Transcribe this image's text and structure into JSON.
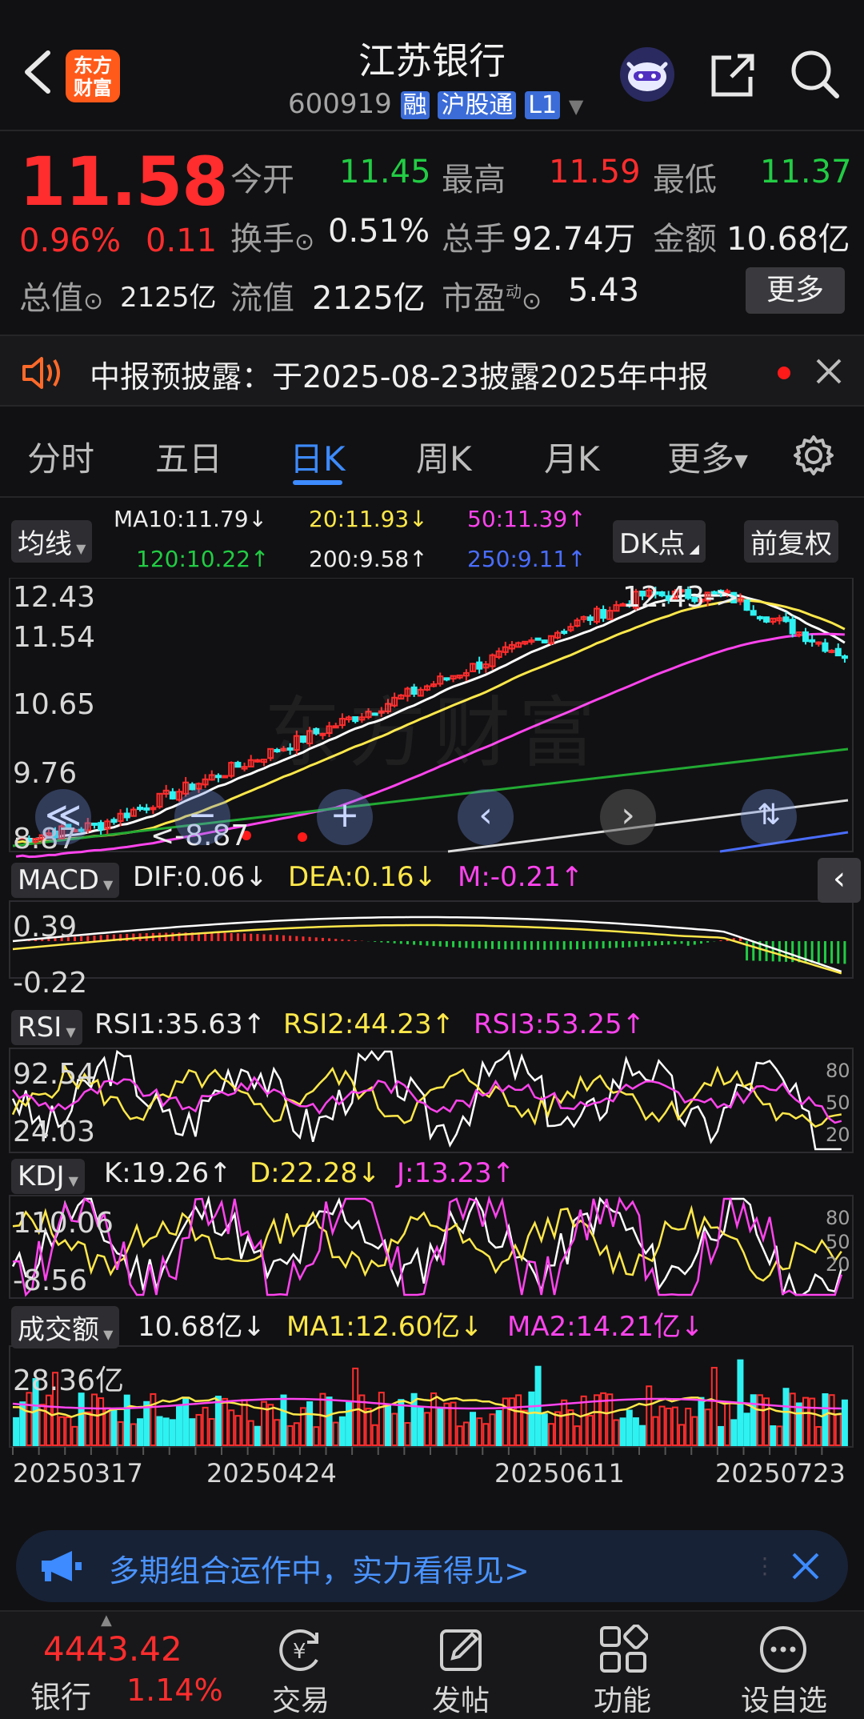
{
  "header": {
    "title": "江苏银行",
    "code": "600919",
    "badges": [
      "融",
      "沪股通",
      "L1"
    ],
    "logo_text": "东方\n财富"
  },
  "quote": {
    "price": "11.58",
    "change_pct": "0.96%",
    "change": "0.11",
    "open_label": "今开",
    "open": "11.45",
    "high_label": "最高",
    "high": "11.59",
    "low_label": "最低",
    "low": "11.37",
    "turnover_label": "换手",
    "turnover": "0.51%",
    "volume_label": "总手",
    "volume": "92.74万",
    "amount_label": "金额",
    "amount": "10.68亿",
    "mktcap_label": "总值",
    "mktcap": "2125亿",
    "float_label": "流值",
    "float": "2125亿",
    "pe_label": "市盈",
    "pe_sup": "动",
    "pe": "5.43",
    "more_label": "更多"
  },
  "notice": {
    "text": "中报预披露：于2025-08-23披露2025年中报"
  },
  "tabs": [
    {
      "label": "分时"
    },
    {
      "label": "五日"
    },
    {
      "label": "日K"
    },
    {
      "label": "周K"
    },
    {
      "label": "月K"
    },
    {
      "label": "更多"
    }
  ],
  "ma": {
    "selector": "均线",
    "ma10": "MA10:11.79↓",
    "ma20": "20:11.93↓",
    "ma50": "50:11.39↑",
    "ma120": "120:10.22↑",
    "ma200": "200:9.58↑",
    "ma250": "250:9.11↑",
    "dk": "DK点",
    "fq": "前复权"
  },
  "kline": {
    "axis": [
      "12.43",
      "11.54",
      "10.65",
      "9.76",
      "8.87"
    ],
    "high_mark": "12.43->",
    "low_mark": "<-8.87",
    "watermark": "东方财富"
  },
  "macd": {
    "selector": "MACD",
    "dif": "DIF:0.06↓",
    "dea": "DEA:0.16↓",
    "m": "M:-0.21↑",
    "axis_top": "0.39",
    "axis_bottom": "-0.22"
  },
  "rsi": {
    "selector": "RSI",
    "rsi1": "RSI1:35.63↑",
    "rsi2": "RSI2:44.23↑",
    "rsi3": "RSI3:53.25↑",
    "axis_top": "92.54",
    "axis_bottom": "24.03",
    "lvl_80": "80",
    "lvl_50": "50",
    "lvl_20": "20"
  },
  "kdj": {
    "selector": "KDJ",
    "k": "K:19.26↑",
    "d": "D:22.28↓",
    "j": "J:13.23↑",
    "axis_top": "110.06",
    "axis_bottom": "-8.56",
    "lvl_80": "80",
    "lvl_50": "50",
    "lvl_20": "20"
  },
  "amount": {
    "selector": "成交额",
    "val": "10.68亿↓",
    "ma1": "MA1:12.60亿↓",
    "ma2": "MA2:14.21亿↓",
    "axis_top": "28.36亿"
  },
  "dates": [
    "20250317",
    "20250424",
    "20250611",
    "20250723"
  ],
  "ad": {
    "text": "多期组合运作中，实力看得见>"
  },
  "bottom": {
    "index_value": "4443.42",
    "index_name": "银行",
    "index_change": "1.14%",
    "items": [
      {
        "label": "交易"
      },
      {
        "label": "发帖"
      },
      {
        "label": "功能"
      },
      {
        "label": "设自选"
      }
    ]
  },
  "colors": {
    "up": "#ff2d2d",
    "down": "#22cc44",
    "ma10": "#ffffff",
    "ma20": "#ffe84a",
    "ma50": "#ff44ee",
    "ma120": "#22aa33",
    "ma200": "#dddddd",
    "ma250": "#4a6dff",
    "accent_blue": "#3d8bff"
  }
}
